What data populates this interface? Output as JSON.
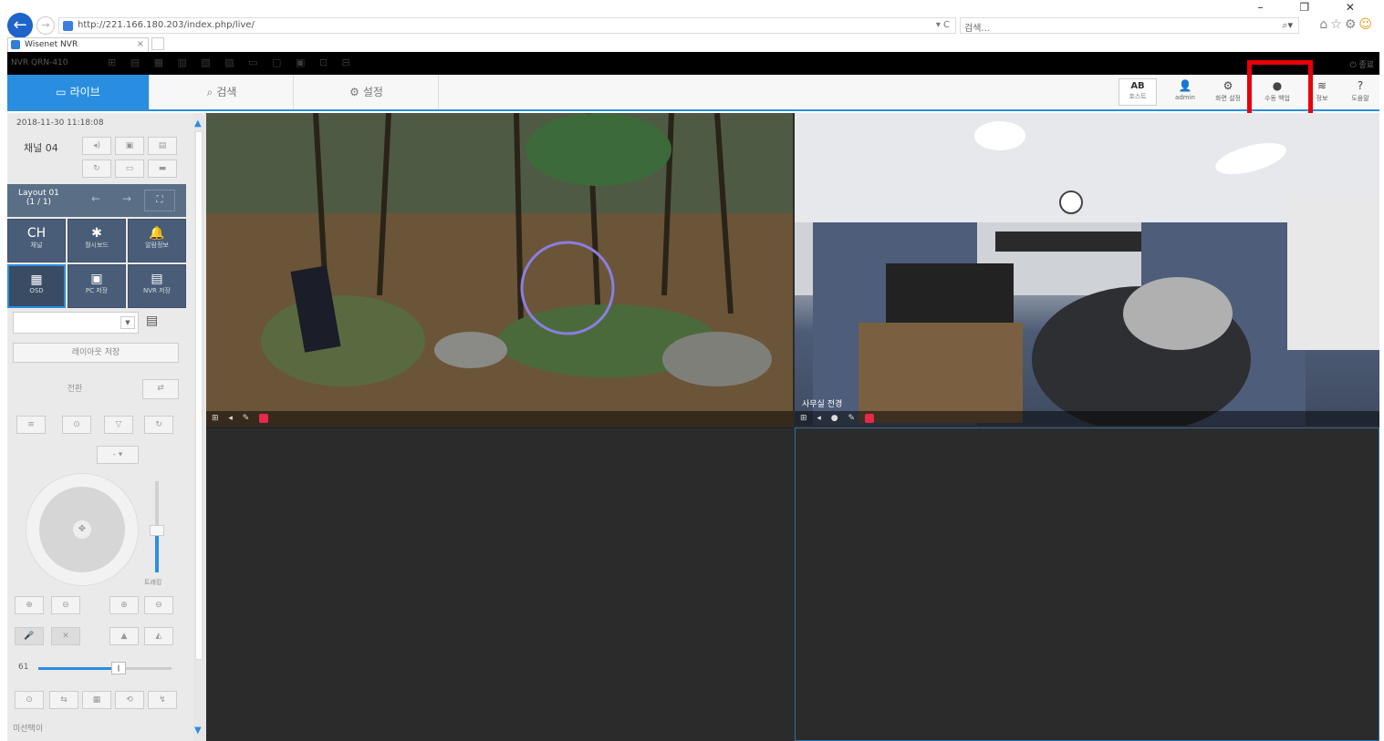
{
  "browser": {
    "url": "http://221.166.180.203/index.php/live/",
    "url_controls": "▾ C",
    "search_placeholder": "검색...",
    "search_icon": "search-icon",
    "tab_title": "Wisenet NVR",
    "tab_close": "×",
    "window_controls": "– ❐ ✕",
    "toolbar_icons": "⌂☆⚙",
    "toolbar_smile": "☺"
  },
  "nvr_bar": {
    "model": "NVR QRN-410",
    "logout": "⏻ 종료"
  },
  "menu": {
    "tabs": [
      {
        "icon": "▭",
        "label": "라이브"
      },
      {
        "icon": "⌕",
        "label": "검색"
      },
      {
        "icon": "⚙",
        "label": "설정"
      }
    ],
    "right_buttons": [
      {
        "icon": "AB",
        "label": "호스트"
      },
      {
        "icon": "👤",
        "label": "admin"
      },
      {
        "icon": "⚙",
        "label": "화면 설정"
      },
      {
        "icon": "●",
        "label": "수동 백업"
      },
      {
        "icon": "≋",
        "label": "정보"
      },
      {
        "icon": "?",
        "label": "도움말"
      }
    ]
  },
  "sidebar": {
    "datetime": "2018-11-30  11:18:08",
    "channel": "채널 04",
    "layout_label": "Layout 01",
    "layout_page": "(1 / 1)",
    "grid_buttons": [
      {
        "icon": "CH",
        "label": "채널"
      },
      {
        "icon": "✱",
        "label": "월시보드"
      },
      {
        "icon": "🔔",
        "label": "알람정보"
      },
      {
        "icon": "▦",
        "label": "OSD"
      },
      {
        "icon": "▣",
        "label": "PC 저장"
      },
      {
        "icon": "▤",
        "label": "NVR 저장"
      }
    ],
    "save_layout": "레이아웃 저장",
    "switch_label": "전환",
    "zoom_label": "트래킹",
    "speed_value": "61",
    "preset_label": "미선택이"
  },
  "cameras": [
    {
      "name": "",
      "controls": "⊞ ◂ ✎",
      "recording": true
    },
    {
      "name": "사무실 전경",
      "controls": "⊞ ◂ ● ✎",
      "recording": true
    },
    {
      "name": "",
      "controls": "",
      "recording": false
    },
    {
      "name": "",
      "controls": "",
      "recording": false
    }
  ],
  "colors": {
    "accent": "#2a8ee0",
    "highlight_box": "#e8000a",
    "sidebar_dark": "#4a5d78",
    "video_bg": "#2b2b2b"
  },
  "highlighted_button": "수동 백업"
}
